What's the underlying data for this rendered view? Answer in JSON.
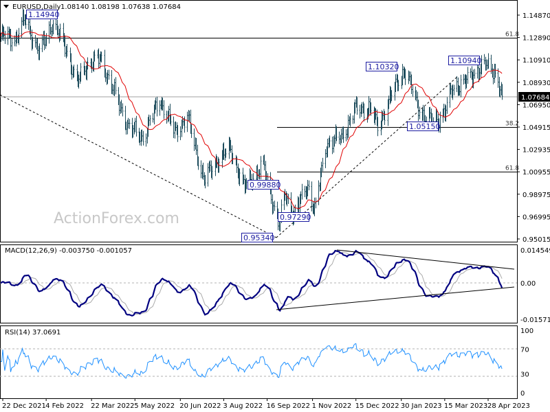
{
  "header": {
    "symbol": "EURUSD,Daily",
    "ohlc": "1.08140 1.08198 1.07638 1.07684"
  },
  "watermark": "ActionForex.com",
  "colors": {
    "bars": "#1d4c5c",
    "ma": "#e00000",
    "macd": "#000080",
    "signal": "#aaaaaa",
    "rsi": "#1e90ff",
    "current_price_bg": "#000000"
  },
  "chart_data": [
    {
      "type": "ohlc-bar",
      "title": "EURUSD,Daily",
      "ylim": [
        0.95015,
        1.1487
      ],
      "y_ticks": [
        "1.14870",
        "1.12890",
        "1.10910",
        "1.08930",
        "1.06950",
        "1.04915",
        "1.02935",
        "1.00955",
        "0.98975",
        "0.96995",
        "0.95015"
      ],
      "x_ticks": [
        "22 Dec 2021",
        "4 Feb 2022",
        "22 Mar 2022",
        "5 May 2022",
        "20 Jun 2022",
        "3 Aug 2022",
        "16 Sep 2022",
        "1 Nov 2022",
        "15 Dec 2022",
        "30 Jan 2023",
        "15 Mar 2023",
        "28 Apr 2023"
      ],
      "x_tick_dates": [
        "2021-12-22",
        "2022-02-04",
        "2022-03-22",
        "2022-05-05",
        "2022-06-20",
        "2022-08-03",
        "2022-09-16",
        "2022-11-01",
        "2022-12-15",
        "2023-01-30",
        "2023-03-15",
        "2023-04-28"
      ],
      "current_price": "1.07684",
      "approx_closes": [
        [
          "2021-12-20",
          1.13
        ],
        [
          "2022-01-04",
          1.128
        ],
        [
          "2022-01-13",
          1.145
        ],
        [
          "2022-01-28",
          1.115
        ],
        [
          "2022-02-10",
          1.142
        ],
        [
          "2022-02-24",
          1.12
        ],
        [
          "2022-03-07",
          1.088
        ],
        [
          "2022-03-17",
          1.105
        ],
        [
          "2022-03-31",
          1.11
        ],
        [
          "2022-04-14",
          1.08
        ],
        [
          "2022-04-28",
          1.05
        ],
        [
          "2022-05-13",
          1.04
        ],
        [
          "2022-05-30",
          1.074
        ],
        [
          "2022-06-14",
          1.045
        ],
        [
          "2022-06-27",
          1.058
        ],
        [
          "2022-07-14",
          1.002
        ],
        [
          "2022-07-27",
          1.02
        ],
        [
          "2022-08-10",
          1.03
        ],
        [
          "2022-08-23",
          0.996
        ],
        [
          "2022-09-12",
          1.015
        ],
        [
          "2022-09-28",
          0.962
        ],
        [
          "2022-10-04",
          0.99
        ],
        [
          "2022-10-13",
          0.972
        ],
        [
          "2022-10-27",
          0.998
        ],
        [
          "2022-11-03",
          0.975
        ],
        [
          "2022-11-15",
          1.035
        ],
        [
          "2022-11-30",
          1.04
        ],
        [
          "2022-12-14",
          1.065
        ],
        [
          "2022-12-29",
          1.066
        ],
        [
          "2023-01-06",
          1.05
        ],
        [
          "2023-01-26",
          1.09
        ],
        [
          "2023-02-02",
          1.1
        ],
        [
          "2023-02-16",
          1.068
        ],
        [
          "2023-02-24",
          1.055
        ],
        [
          "2023-03-08",
          1.057
        ],
        [
          "2023-03-15",
          1.062
        ],
        [
          "2023-03-23",
          1.085
        ],
        [
          "2023-04-03",
          1.088
        ],
        [
          "2023-04-14",
          1.098
        ],
        [
          "2023-04-26",
          1.105
        ],
        [
          "2023-05-04",
          1.1
        ],
        [
          "2023-05-12",
          1.0768
        ]
      ],
      "series": [
        {
          "name": "MA",
          "color": "#e00000"
        }
      ],
      "price_labels": [
        "1.14940",
        "1.10320",
        "1.10940",
        "1.05150",
        "0.99880",
        "0.97290",
        "0.95340"
      ],
      "fib_levels": [
        {
          "label": "61.8",
          "price": 1.1289
        },
        {
          "label": "38.2",
          "price": 1.0495
        },
        {
          "label": "61.8",
          "price": 1.01
        }
      ]
    },
    {
      "type": "line",
      "title": "MACD(12,26,9) -0.003750 -0.001057",
      "ylim": [
        -0.015712,
        0.014549
      ],
      "y_ticks": [
        "0.014549",
        "0.00",
        "-0.015712"
      ]
    },
    {
      "type": "line",
      "title": "RSI(14) 37.0691",
      "ylim": [
        0,
        100
      ],
      "y_ticks": [
        "100",
        "70",
        "30",
        "0"
      ],
      "levels": [
        70,
        30
      ]
    }
  ]
}
